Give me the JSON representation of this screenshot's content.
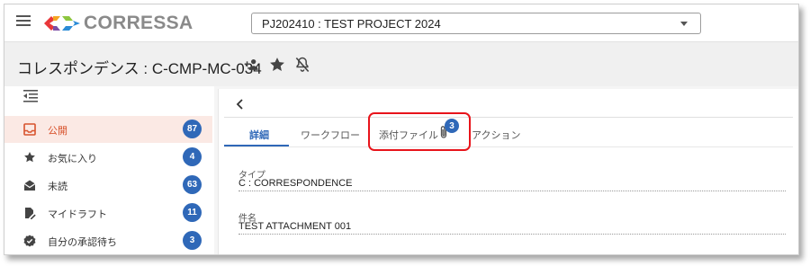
{
  "app": {
    "brand_name": "CORRESSA",
    "brand_colors": [
      "#e9373a",
      "#f4a623",
      "#8dc63f",
      "#2b8bd6",
      "#7b4fa6"
    ]
  },
  "header": {
    "project_selector": {
      "value": "PJ202410 : TEST PROJECT 2024"
    }
  },
  "title_bar": {
    "title": "コレスポンデンス : C-CMP-MC-034",
    "icons": [
      "add-person-icon",
      "star-icon",
      "notifications-off-icon"
    ]
  },
  "sidebar": {
    "items": [
      {
        "label": "公開",
        "count": "87",
        "icon": "inbox-icon",
        "active": true
      },
      {
        "label": "お気に入り",
        "count": "4",
        "icon": "star-icon",
        "active": false
      },
      {
        "label": "未読",
        "count": "63",
        "icon": "open-mail-icon",
        "active": false
      },
      {
        "label": "マイドラフト",
        "count": "11",
        "icon": "draft-edit-icon",
        "active": false
      },
      {
        "label": "自分の承認待ち",
        "count": "3",
        "icon": "verified-icon",
        "active": false
      }
    ]
  },
  "tabs": [
    {
      "label": "詳細",
      "active": true
    },
    {
      "label": "ワークフロー",
      "active": false
    },
    {
      "label": "添付ファイル",
      "active": false,
      "badge": "3"
    },
    {
      "label": "アクション",
      "active": false
    }
  ],
  "fields": [
    {
      "label": "タイプ",
      "value": "C : CORRESPONDENCE"
    },
    {
      "label": "件名",
      "value": "TEST ATTACHMENT 001"
    }
  ],
  "colors": {
    "accent": "#2f68b8",
    "active_nav": "#d8532d",
    "highlight": "#e8141b"
  }
}
